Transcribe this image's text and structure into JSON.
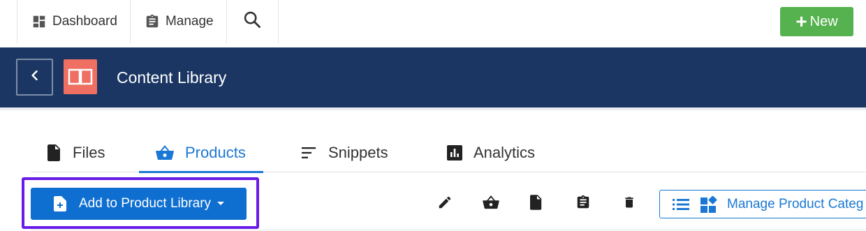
{
  "topnav": {
    "dashboard_label": "Dashboard",
    "manage_label": "Manage",
    "new_label": "New"
  },
  "header": {
    "title": "Content Library"
  },
  "tabs": [
    {
      "label": "Files",
      "icon": "file-icon"
    },
    {
      "label": "Products",
      "icon": "basket-icon",
      "active": true
    },
    {
      "label": "Snippets",
      "icon": "lines-icon"
    },
    {
      "label": "Analytics",
      "icon": "bar-chart-icon"
    }
  ],
  "toolbar": {
    "add_label": "Add to Product Library",
    "manage_categories_label": "Manage Product Categ",
    "icons": [
      "pencil-icon",
      "basket-icon",
      "file-icon",
      "clipboard-icon",
      "trash-icon"
    ]
  },
  "colors": {
    "header_bg": "#1b3663",
    "accent": "#1a78d4",
    "new_button": "#55b24f",
    "library_icon_bg": "#ef6f63",
    "highlight_border": "#6a1be8"
  }
}
